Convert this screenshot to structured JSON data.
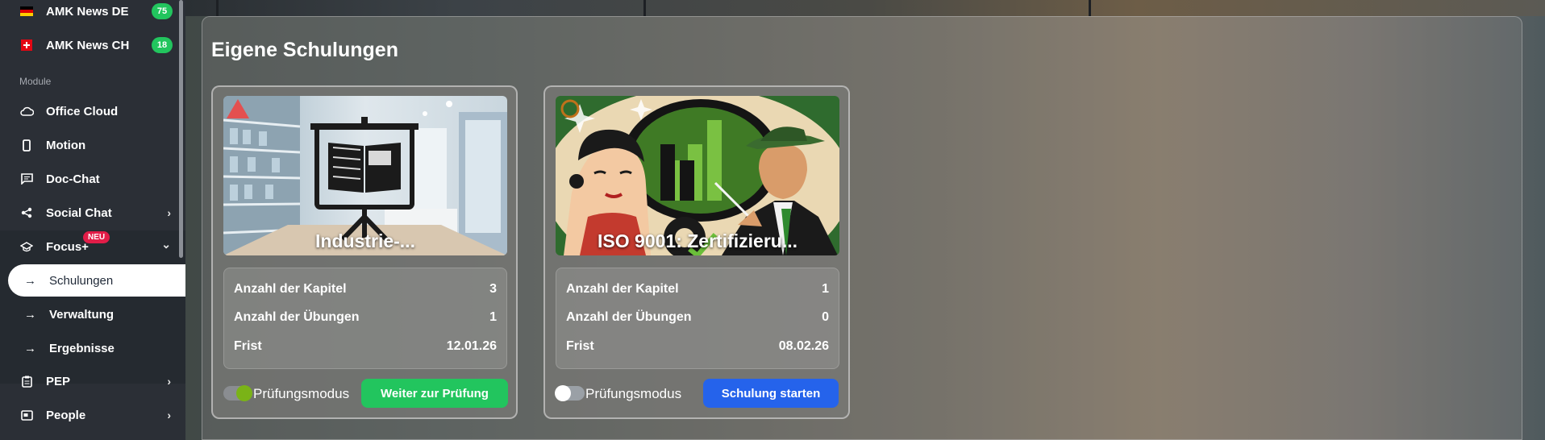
{
  "sidebar": {
    "top_items": [
      {
        "label": "AMK News DE",
        "badge": "75",
        "icon": "flag-de-icon"
      },
      {
        "label": "AMK News CH",
        "badge": "18",
        "icon": "flag-ch-icon"
      }
    ],
    "section_label": "Module",
    "items": [
      {
        "label": "Office Cloud",
        "icon": "cloud-icon"
      },
      {
        "label": "Motion",
        "icon": "phone-icon"
      },
      {
        "label": "Doc-Chat",
        "icon": "chat-icon"
      },
      {
        "label": "Social Chat",
        "icon": "share-icon",
        "chevron": "›"
      },
      {
        "label": "Focus+",
        "icon": "graduation-cap-icon",
        "chevron": "⌄",
        "badge": "NEU"
      }
    ],
    "sub_items": [
      {
        "label": "Schulungen",
        "active": true
      },
      {
        "label": "Verwaltung"
      },
      {
        "label": "Ergebnisse"
      }
    ],
    "bottom_items": [
      {
        "label": "PEP",
        "icon": "clipboard-icon",
        "chevron": "›"
      },
      {
        "label": "People",
        "icon": "id-card-icon",
        "chevron": "›"
      }
    ],
    "arrow_glyph": "→"
  },
  "main": {
    "title": "Eigene Schulungen",
    "cards": [
      {
        "title": "Industrie-...",
        "stats": [
          {
            "label": "Anzahl der Kapitel",
            "value": "3"
          },
          {
            "label": "Anzahl der Übungen",
            "value": "1"
          },
          {
            "label": "Frist",
            "value": "12.01.26"
          }
        ],
        "toggle_label": "Prüfungsmodus",
        "toggle_on": true,
        "button_label": "Weiter zur Prüfung",
        "button_color": "#22c55e"
      },
      {
        "title": "ISO 9001: Zertifizieru...",
        "stats": [
          {
            "label": "Anzahl der Kapitel",
            "value": "1"
          },
          {
            "label": "Anzahl der Übungen",
            "value": "0"
          },
          {
            "label": "Frist",
            "value": "08.02.26"
          }
        ],
        "toggle_label": "Prüfungsmodus",
        "toggle_on": false,
        "button_label": "Schulung starten",
        "button_color": "#2563eb"
      }
    ]
  }
}
